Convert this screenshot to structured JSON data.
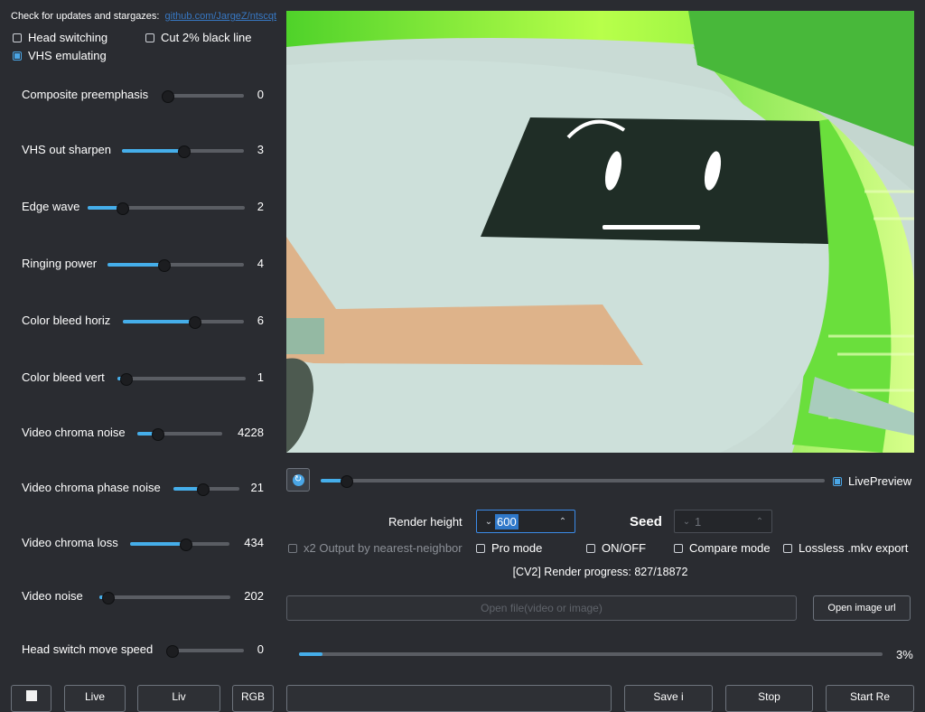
{
  "header": {
    "updates_text": "Check for updates and stargazes:",
    "link_text": "github.com/JargeZ/ntscqt"
  },
  "options": {
    "head_switching": {
      "label": "Head switching",
      "checked": false
    },
    "cut_black_line": {
      "label": "Cut 2% black line",
      "checked": false
    },
    "vhs_emulating": {
      "label": "VHS emulating",
      "checked": true
    }
  },
  "sliders": [
    {
      "label": "Composite preemphasis",
      "value": "0",
      "fraction": 0.0
    },
    {
      "label": "VHS out sharpen",
      "value": "3",
      "fraction": 0.5
    },
    {
      "label": "Edge wave",
      "value": "2",
      "fraction": 0.22
    },
    {
      "label": "Ringing power",
      "value": "4",
      "fraction": 0.41
    },
    {
      "label": "Color bleed horiz",
      "value": "6",
      "fraction": 0.59
    },
    {
      "label": "Color bleed vert",
      "value": "1",
      "fraction": 0.06
    },
    {
      "label": "Video chroma noise",
      "value": "4228",
      "fraction": 0.23
    },
    {
      "label": "Video chroma phase noise",
      "value": "21",
      "fraction": 0.44
    },
    {
      "label": "Video chroma loss",
      "value": "434",
      "fraction": 0.55
    },
    {
      "label": "Video noise",
      "value": "202",
      "fraction": 0.06
    },
    {
      "label": "Head switch move speed",
      "value": "0",
      "fraction": 0.0
    }
  ],
  "preview": {
    "live_preview": {
      "label": "LivePreview",
      "checked": true
    },
    "timeline_fraction": 0.05
  },
  "render": {
    "height_label": "Render height",
    "height_value": "600",
    "seed_label": "Seed",
    "seed_value": "1"
  },
  "flags": {
    "x2_output": {
      "label": "x2 Output by nearest-neighbor",
      "checked": false
    },
    "pro_mode": {
      "label": "Pro mode",
      "checked": false
    },
    "on_off": {
      "label": "ON/OFF",
      "checked": false
    },
    "compare_mode": {
      "label": "Compare mode",
      "checked": false
    },
    "lossless": {
      "label": "Lossless .mkv export",
      "checked": false
    }
  },
  "progress": {
    "text": "[CV2] Render progress: 827/18872",
    "percent_label": "3%",
    "fraction": 0.04
  },
  "files": {
    "open_files_label": "Open file(video or image)",
    "open_url_label": "Open image url"
  },
  "bottom_buttons": [
    "",
    "Live",
    "Liv",
    "RGB",
    "",
    "Save i",
    "Stop",
    "Start Re"
  ],
  "colors": {
    "background": "#2a2c31",
    "accent": "#45aeea",
    "link": "#3b8be8"
  }
}
